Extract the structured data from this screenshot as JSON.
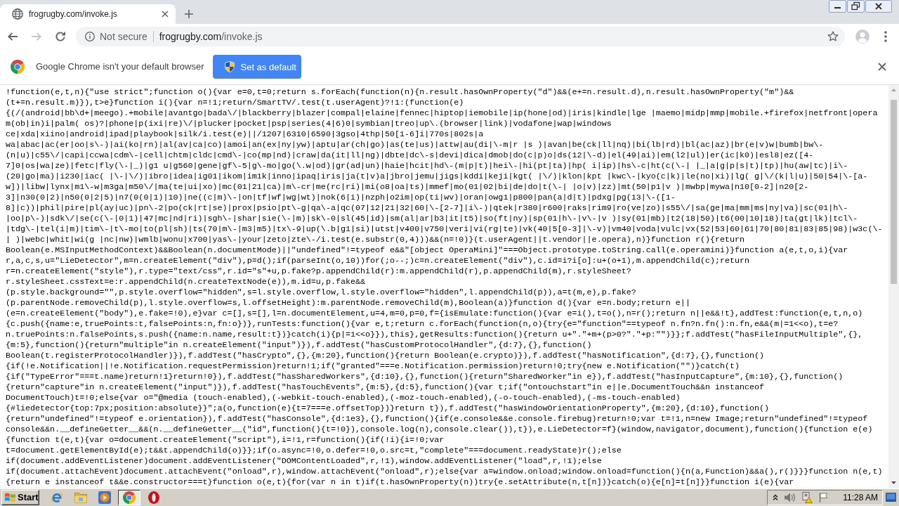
{
  "browser": {
    "tabs": [
      {
        "title": "frogrugby.com/invoke.js",
        "selected": true
      }
    ],
    "back_disabled": false,
    "forward_disabled": true,
    "address_bar": {
      "security_label": "Not secure",
      "host": "frogrugby.com",
      "path": "/invoke.js"
    }
  },
  "infobar": {
    "message": "Google Chrome isn't your default browser",
    "button": "Set as default"
  },
  "document": {
    "lines": [
      "!function(e,t,n){\"use strict\";function o(){var e=0,t=0;return s.forEach(function(n){n.result.hasOwnProperty(\"d\")&&(e+=n.result.d),n.result.hasOwnProperty(\"m\")&&",
      "(t+=n.result.m)}),t>e}function i(){var n=!1;return/SmartTV/.test(t.userAgent)?!1:(function(e)",
      "{(/(android|bb\\d+|meego).+mobile|avantgo|bada\\/|blackberry|blazer|compal|elaine|fennec|hiptop|iemobile|ip(hone|od)|iris|kindle|lge |maemo|midp|mmp|mobile.+firefox|netfront|opera",
      "m(ob|in)i|palm( os)?|phone|p(ixi|re)\\/|plucker|pocket|psp|series(4|6)0|symbian|treo|up\\.(browser|link)|vodafone|wap|windows",
      "ce|xda|xiino|android|ipad|playbook|silk/i.test(e)||/1207|6310|6590|3gso|4thp|50[1-6]i|770s|802s|a",
      "wa|abac|ac(er|oo|s\\-)|ai(ko|rn)|al(av|ca|co)|amoi|an(ex|ny|yw)|aptu|ar(ch|go)|as(te|us)|attw|au(di|\\-m|r |s )|avan|be(ck|ll|nq)|bi(lb|rd)|bl(ac|az)|br(e|v)w|bumb|bw\\-",
      "(n|u)|c55\\/|capi|ccwa|cdm\\-|cell|chtm|cldc|cmd\\-|co(mp|nd)|craw|da(it|ll|ng)|dbte|dc\\-s|devi|dica|dmob|do(c|p)o|ds(12|\\-d)|el(49|ai)|em(l2|ul)|er(ic|k0)|esl8|ez([4-",
      "7]0|os|wa|ze)|fetc|fly(\\-|_)|g1 u|g560|gene|gf\\-5|g\\-mo|go(\\.w|od)|gr(ad|un)|haie|hcit|hd\\-(m|p|t)|hei\\-|hi(pt|ta)|hp( i|ip)|hs\\-c|ht(c(\\-| |_|a|g|p|s|t)|tp)|hu(aw|tc)|i\\-",
      "(20|go|ma)|i230|iac( |\\-|\\/)|ibro|idea|ig01|ikom|im1k|inno|ipaq|iris|ja(t|v)a|jbro|jemu|jigs|kddi|keji|kgt( |\\/)|klon|kpt |kwc\\-|kyo(c|k)|le(no|xi)|lg( g|\\/(k|l|u)|50|54|\\-[a-",
      "w])|libw|lynx|m1\\-w|m3ga|m50\\/|ma(te|ui|xo)|mc(01|21|ca)|m\\-cr|me(rc|ri)|mi(o8|oa|ts)|mmef|mo(01|02|bi|de|do|t(\\-| |o|v)|zz)|mt(50|p1|v )|mwbp|mywa|n10[0-2]|n20[2-",
      "3]|n30(0|2)|n50(0|2|5)|n7(0(0|1)|10)|ne((c|m)\\-|on|tf|wf|wg|wt)|nok(6|i)|nzph|o2im|op(ti|wv)|oran|owg1|p800|pan(a|d|t)|pdxg|pg(13|\\-([1-",
      "8]|c))|phil|pire|pl(ay|uc)|pn\\-2|po(ck|rt|se)|prox|psio|pt\\-g|qa\\-a|qc(07|12|21|32|60|\\-[2-7]|i\\-)|qtek|r380|r600|raks|rim9|ro(ve|zo)|s55\\/|sa(ge|ma|mm|ms|ny|va)|sc(01|h\\-",
      "|oo|p\\-)|sdk\\/|se(c(\\-|0|1)|47|mc|nd|ri)|sgh\\-|shar|sie(\\-|m)|sk\\-0|sl(45|id)|sm(al|ar|b3|it|t5)|so(ft|ny)|sp(01|h\\-|v\\-|v )|sy(01|mb)|t2(18|50)|t6(00|10|18)|ta(gt|lk)|tcl\\-",
      "|tdg\\-|tel(i|m)|tim\\-|t\\-mo|to(pl|sh)|ts(70|m\\-|m3|m5)|tx\\-9|up(\\.b|g1|si)|utst|v400|v750|veri|vi(rg|te)|vk(40|5[0-3]|\\-v)|vm40|voda|vulc|vx(52|53|60|61|70|80|81|83|85|98)|w3c(\\-",
      "| )|webc|whit|wi(g |nc|nw)|wmlb|wonu|x700|yas\\-|your|zeto|zte\\-/i.test(e.substr(0,4)))&&(n=!0)}(t.userAgent||t.vendor||e.opera),n)}function r(){return",
      "Boolean(e.MSInputMethodContext)&&Boolean(n.documentMode)||\"undefined\"!=typeof e&&\"[object OperaMini]\"===Object.prototype.toString.call(e.operamini)}function a(e,t,o,i){var",
      "r,a,c,s,u=\"LieDetector\",m=n.createElement(\"div\"),p=d();if(parseInt(o,10))for(;o--;)c=n.createElement(\"div\"),c.id=i?i[o]:u+(o+1),m.appendChild(c);return",
      "r=n.createElement(\"style\"),r.type=\"text/css\",r.id=\"s\"+u,p.fake?p.appendChild(r):m.appendChild(r),p.appendChild(m),r.styleSheet?",
      "r.styleSheet.cssText=e:r.appendChild(n.createTextNode(e)),m.id=u,p.fake&&",
      "(p.style.background=\"\",p.style.overflow=\"hidden\",s=l.style.overflow,l.style.overflow=\"hidden\",l.appendChild(p)),a=t(m,e),p.fake?",
      "(p.parentNode.removeChild(p),l.style.overflow=s,l.offsetHeight):m.parentNode.removeChild(m),Boolean(a)}function d(){var e=n.body;return e||",
      "(e=n.createElement(\"body\"),e.fake=!0),e}var c=[],s=[],l=n.documentElement,u=4,m=0,p=0,f={isEmulate:function(){var e=i(),t=o(),n=r();return n||e&&!t},addTest:function(e,t,n,o)",
      "{c.push({name:e,truePoints:t,falsePoints:n,fn:o})},runTests:function(){var e,t;return c.forEach(function(n,o){try{e=\"function\"==typeof n.fn?n.fn():n.fn,e&&(m|=1<<o),t=e?",
      "n.truePoints:n.falsePoints,s.push({name:n.name,result:t})}catch(i){p|=1<<o}}),this},getResults:function(){return u+\".\"+m+(p>0?\".\"+p:\"\")}};f.addTest(\"hasFileInputMultiple\",{},",
      "{m:5},function(){return\"multiple\"in n.createElement(\"input\")}),f.addTest(\"hasCustomProtocolHandler\",{d:7},{},function()",
      "Boolean(t.registerProtocolHandler)}),f.addTest(\"hasCrypto\",{},{m:20},function(){return Boolean(e.crypto)}),f.addTest(\"hasNotification\",{d:7},{},function()",
      "{if(!e.Notification||!e.Notification.requestPermission)return!1;if(\"granted\"===e.Notification.permission)return!0;try{new e.Notification(\"\")}catch(t)",
      "{if(\"TypeError\"===t.name)return!1}return!0}),f.addTest(\"hasSharedWorkers\",{d:10},{},function(){return\"SharedWorker\"in e}),f.addTest(\"hasInputCapture\",{m:10},{},function()",
      "{return\"capture\"in n.createElement(\"input\")}),f.addTest(\"hasTouchEvents\",{m:5},{d:5},function(){var t;if(\"ontouchstart\"in e||e.DocumentTouch&&n instanceof",
      "DocumentTouch)t=!0;else{var o=\"@media (touch-enabled),(-webkit-touch-enabled),(-moz-touch-enabled),(-o-touch-enabled),(-ms-touch-enabled)",
      "{#liedetector{top:7px;position:absolute}}\";a(o,function(e){t=7===e.offsetTop})}return t}),f.addTest(\"hasWindowOrientationProperty\",{m:20},{d:10},function()",
      "{return\"undefined\"!=typeof e.orientation}),f.addTest(\"hasConsole\",{d:1e3},{},function(){if(e.console&&e.console.firebug)return!0;var t=!1,n=new Image;return\"undefined\"!=typeof",
      "console&&n.__defineGetter__&&(n.__defineGetter__(\"id\",function(){t=!0}),console.log(n),console.clear()),t}),e.LieDetector=f}(window,navigator,document),function(){function e(e)",
      "{function t(e,t){var o=document.createElement(\"script\"),i=!1,r=function(){if(!i){i=!0;var",
      "t=document.getElementById(e);t&&t.appendChild(o)}};if(o.async=!0,o.defer=!0,o.src=t,\"complete\"===document.readyState)r();else",
      "if(document.addEventListener)document.addEventListener(\"DOMContentLoaded\",r,!1),window.addEventListener(\"load\",r,!1);else",
      "if(document.attachEvent)document.attachEvent(\"onload\",r),window.attachEvent(\"onload\",r);else{var a=window.onload;window.onload=function(){n(a,Function)&&a(),r()}}}function n(e,t)",
      "{return e instanceof t&&e.constructor===t}function o(e,t){for(var n in t)if(t.hasOwnProperty(n))try{e.setAttribute(n,t[n])}catch(o){e[n]=t[n]}}function i(e){var"
    ]
  },
  "taskbar": {
    "start": "Start",
    "apps": [
      {
        "active": false
      },
      {
        "active": false
      },
      {
        "active": false
      },
      {
        "active": true
      },
      {
        "active": false
      }
    ],
    "clock": "11:28 AM"
  }
}
